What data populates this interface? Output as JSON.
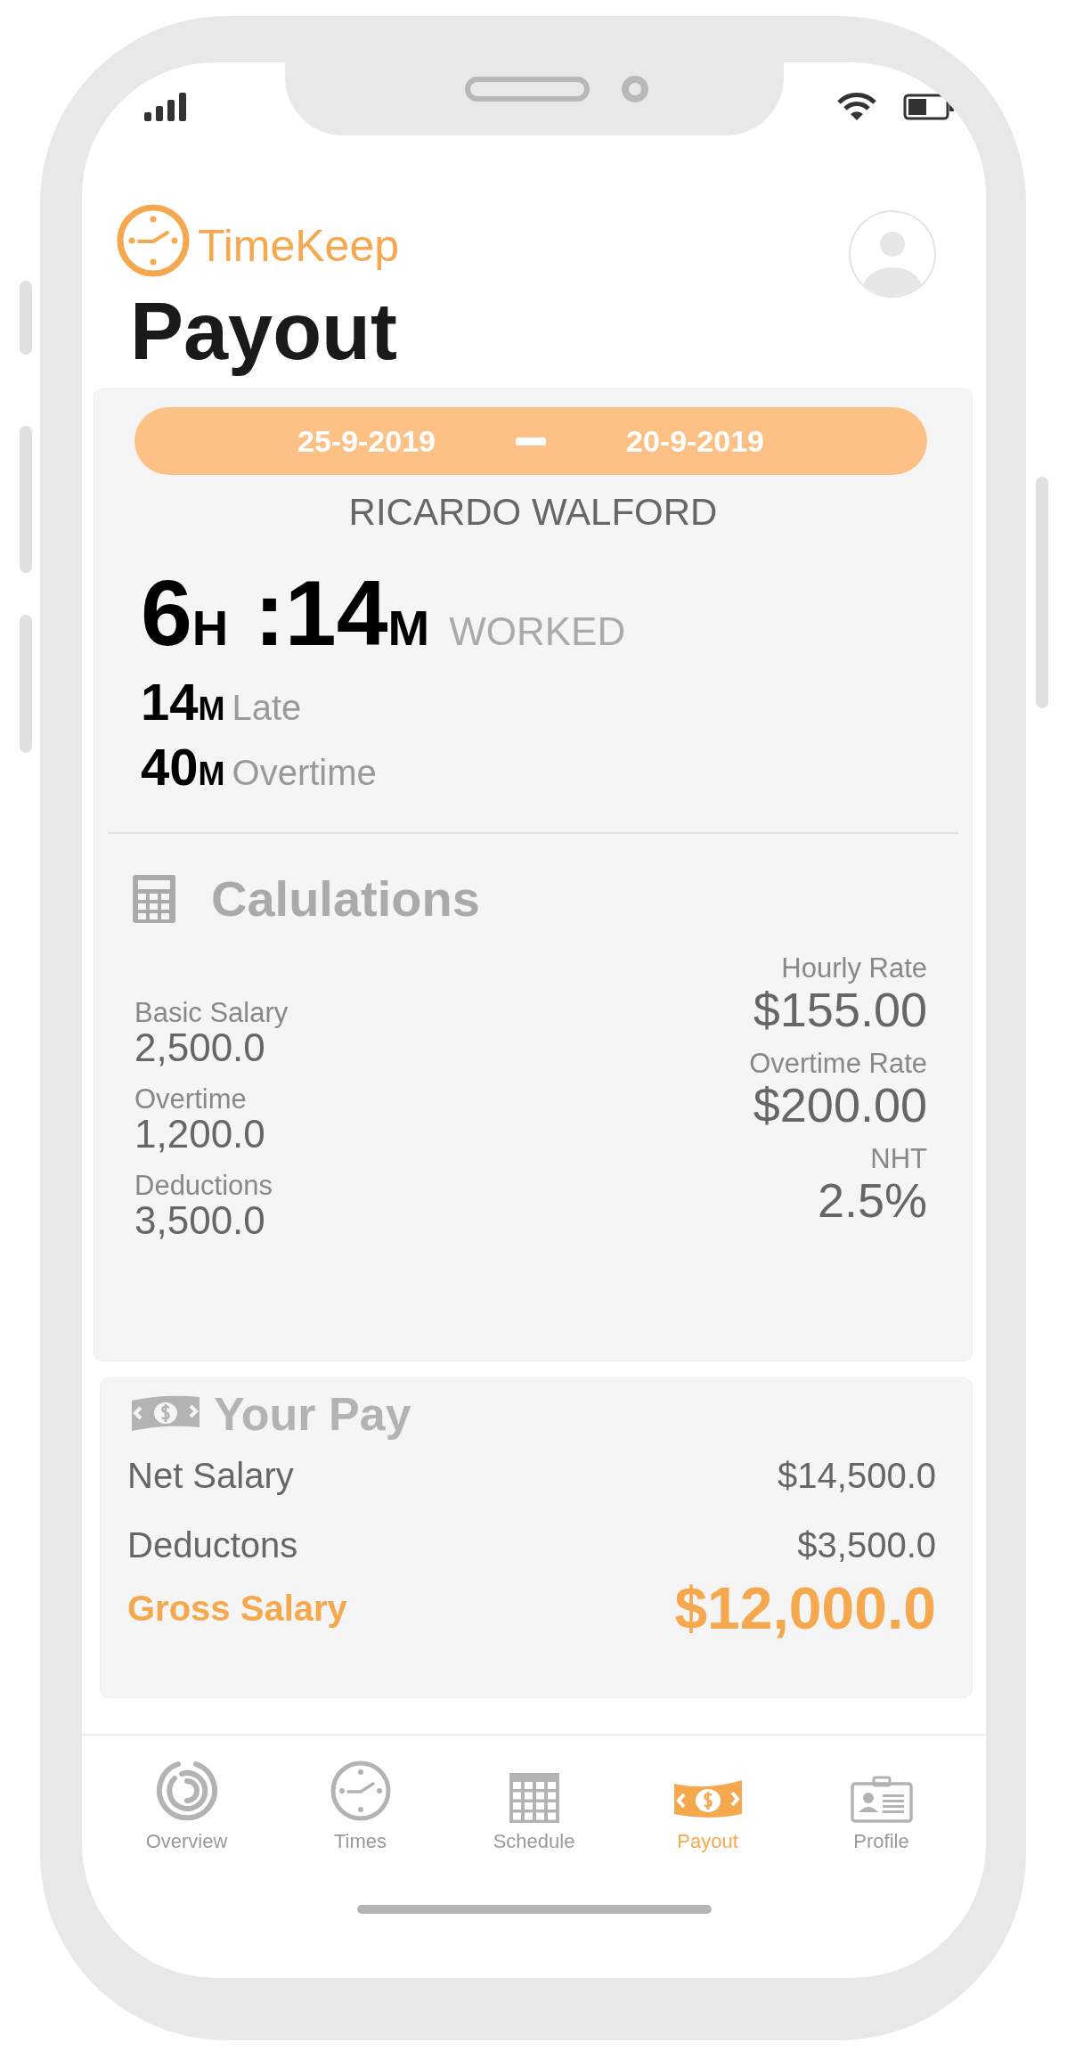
{
  "app": {
    "name": "TimeKeep"
  },
  "page_title": "Payout",
  "summary": {
    "date_from": "25-9-2019",
    "date_to": "20-9-2019",
    "employee": "RICARDO WALFORD",
    "worked": {
      "time": [
        {
          "value": "6",
          "unit": "H"
        },
        {
          "value": " :14",
          "unit": "M"
        }
      ],
      "label": "WORKED"
    },
    "stats": [
      {
        "value": "14",
        "unit": "M",
        "label": "Late"
      },
      {
        "value": "40",
        "unit": "M",
        "label": "Overtime"
      }
    ]
  },
  "calculations": {
    "title": "Calulations",
    "left": [
      {
        "label": "Basic Salary",
        "value": "2,500.0"
      },
      {
        "label": "Overtime",
        "value": "1,200.0"
      },
      {
        "label": "Deductions",
        "value": "3,500.0"
      }
    ],
    "right": [
      {
        "label": "Hourly Rate",
        "value": "$155.00"
      },
      {
        "label": "Overtime Rate",
        "value": "$200.00"
      },
      {
        "label": "NHT",
        "value": "2.5%"
      }
    ]
  },
  "your_pay": {
    "title": "Your Pay",
    "rows": [
      {
        "label": "Net Salary",
        "value": "$14,500.0",
        "kind": "normal"
      },
      {
        "label": "Deductons",
        "value": "$3,500.0",
        "kind": "normal"
      },
      {
        "label": "Gross Salary",
        "value": "$12,000.0",
        "kind": "total"
      }
    ]
  },
  "tab_bar": [
    {
      "label": "Overview",
      "selected": false
    },
    {
      "label": "Times",
      "selected": false
    },
    {
      "label": "Schedule",
      "selected": false
    },
    {
      "label": "Payout",
      "selected": true
    },
    {
      "label": "Profile",
      "selected": false
    }
  ]
}
